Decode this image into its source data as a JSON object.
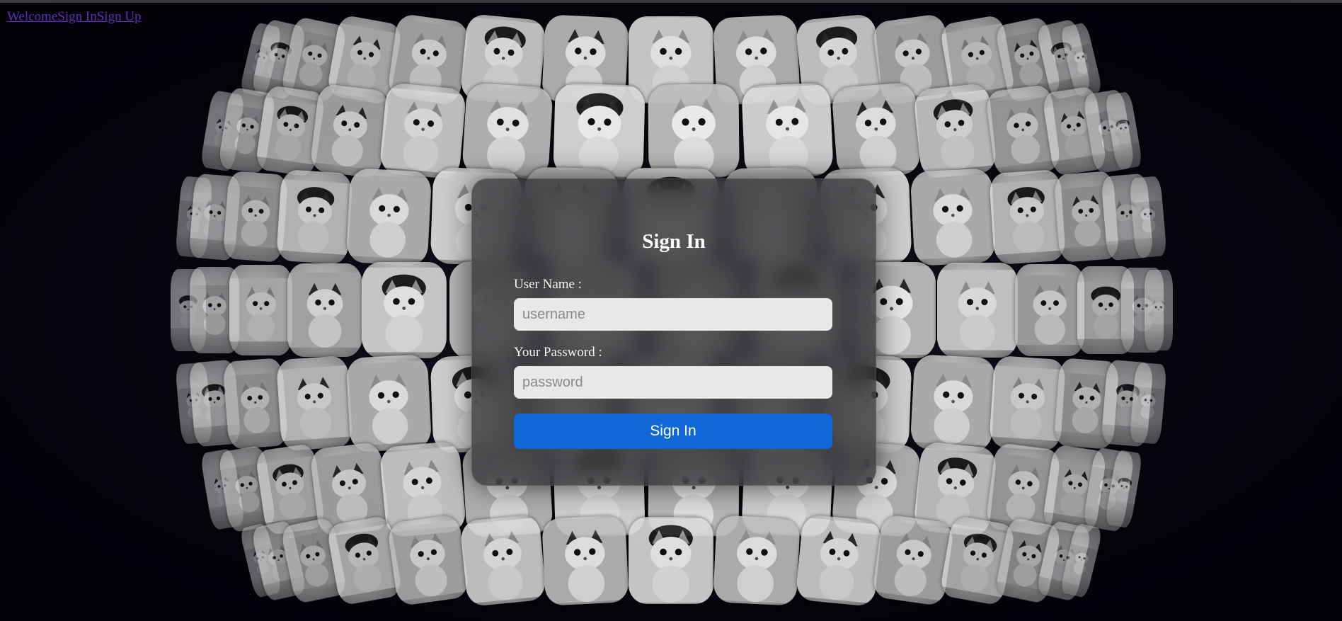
{
  "nav": {
    "links": [
      "Welcome",
      "Sign In",
      "Sign Up"
    ]
  },
  "background": {
    "tile_image": "kitten-photo",
    "tile_style": "grayscale"
  },
  "form": {
    "title": "Sign In",
    "username_label": "User Name :",
    "username_placeholder": "username",
    "username_value": "",
    "password_label": "Your Password :",
    "password_placeholder": "password",
    "password_value": "",
    "submit_label": "Sign In",
    "submit_color": "#1068d8"
  }
}
